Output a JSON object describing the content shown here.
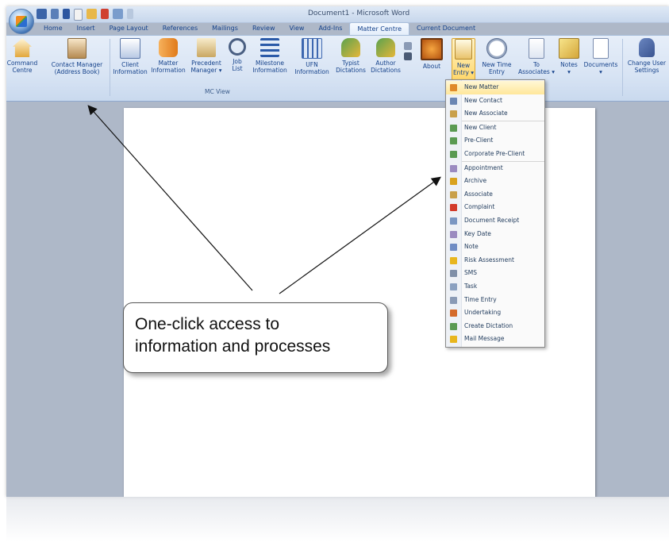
{
  "window": {
    "title": "Document1 - Microsoft Word"
  },
  "tabs": [
    "Home",
    "Insert",
    "Page Layout",
    "References",
    "Mailings",
    "Review",
    "View",
    "Add-Ins",
    "Matter Centre",
    "Current Document"
  ],
  "active_tab": "Matter Centre",
  "ribbon": {
    "buttons": {
      "command_centre": "Command\nCentre",
      "contact_manager": "Contact Manager\n(Address Book)",
      "client_info": "Client\nInformation",
      "matter_info": "Matter\nInformation",
      "precedent_manager": "Precedent\nManager ▾",
      "job_list": "Job\nList",
      "milestone_info": "Milestone\nInformation",
      "ufn_info": "UFN\nInformation",
      "typist_dictations": "Typist\nDictations",
      "author_dictations": "Author\nDictations",
      "about": "About",
      "new_entry": "New\nEntry ▾",
      "new_time_entry": "New Time\nEntry",
      "to_associates": "To\nAssociates ▾",
      "notes": "Notes\n▾",
      "documents": "Documents\n▾",
      "change_user_settings": "Change User\nSettings"
    },
    "group_label": "MC View"
  },
  "new_entry_menu": [
    {
      "label": "New Matter",
      "icon": "matter-icon",
      "color": "#e08a2a"
    },
    {
      "label": "New Contact",
      "icon": "contact-card-icon",
      "color": "#6b86b3"
    },
    {
      "label": "New Associate",
      "icon": "associate-icon",
      "color": "#c9a04a"
    },
    {
      "sep": true
    },
    {
      "label": "New Client",
      "icon": "client-icon",
      "color": "#5a9a52"
    },
    {
      "label": "Pre-Client",
      "icon": "pre-client-icon",
      "color": "#5a9a52"
    },
    {
      "label": "Corporate Pre-Client",
      "icon": "corporate-client-icon",
      "color": "#5a9a52"
    },
    {
      "sep": true
    },
    {
      "label": "Appointment",
      "icon": "calendar-icon",
      "color": "#9a8ac0"
    },
    {
      "label": "Archive",
      "icon": "archive-icon",
      "color": "#d9a21e"
    },
    {
      "label": "Associate",
      "icon": "associate-icon",
      "color": "#c9a04a"
    },
    {
      "label": "Complaint",
      "icon": "exclamation-icon",
      "color": "#d23a2a"
    },
    {
      "label": "Document Receipt",
      "icon": "document-icon",
      "color": "#7a96c2"
    },
    {
      "label": "Key Date",
      "icon": "calendar-key-icon",
      "color": "#9a8ac0"
    },
    {
      "label": "Note",
      "icon": "note-icon",
      "color": "#6f8cc4"
    },
    {
      "label": "Risk Assessment",
      "icon": "warning-icon",
      "color": "#e8b61e"
    },
    {
      "label": "SMS",
      "icon": "phone-icon",
      "color": "#7f8fa8"
    },
    {
      "label": "Task",
      "icon": "task-icon",
      "color": "#8aa0c0"
    },
    {
      "label": "Time Entry",
      "icon": "clock-icon",
      "color": "#8a9ab5"
    },
    {
      "label": "Undertaking",
      "icon": "undertaking-icon",
      "color": "#d46a2a"
    },
    {
      "label": "Create Dictation",
      "icon": "dictation-icon",
      "color": "#5a9a52"
    },
    {
      "label": "Mail Message",
      "icon": "mail-icon",
      "color": "#e8b61e"
    }
  ],
  "callout": {
    "line1": "One-click access to",
    "line2": "information and processes"
  }
}
